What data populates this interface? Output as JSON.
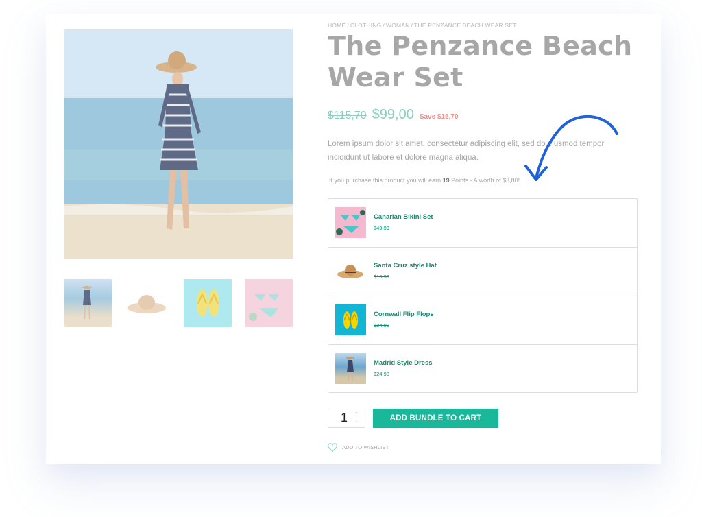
{
  "breadcrumb": {
    "items": [
      "HOME",
      "CLOTHING",
      "WOMAN",
      "THE PENZANCE BEACH WEAR SET"
    ],
    "separator": "/"
  },
  "product": {
    "title": "The Penzance Beach Wear Set",
    "old_price": "$115,70",
    "new_price": "$99,00",
    "save_text": "Save $16,70",
    "description": "Lorem ipsum dolor sit amet, consectetur adipiscing elit, sed do eiusmod tempor incididunt ut labore et dolore magna aliqua.",
    "points": {
      "prefix": "If you purchase this product you will earn ",
      "count": "19",
      "suffix": " Points - A worth of $3,80!"
    }
  },
  "bundle": {
    "items": [
      {
        "name": "Canarian Bikini Set",
        "price": "$49,99",
        "icon": "bikini-icon"
      },
      {
        "name": "Santa Cruz style Hat",
        "price": "$15,90",
        "icon": "hat-icon"
      },
      {
        "name": "Cornwall Flip Flops",
        "price": "$24,90",
        "icon": "flip-flops-icon"
      },
      {
        "name": "Madrid Style Dress",
        "price": "$24,90",
        "icon": "dress-icon"
      }
    ]
  },
  "cart": {
    "quantity": "1",
    "add_label": "ADD BUNDLE TO CART"
  },
  "wishlist": {
    "label": "ADD TO WISHLIST"
  },
  "colors": {
    "accent": "#19b89a",
    "title": "#a7a7a7",
    "price": "#8ccfc0",
    "save": "#f08d8d",
    "arrow": "#1f63d6"
  }
}
